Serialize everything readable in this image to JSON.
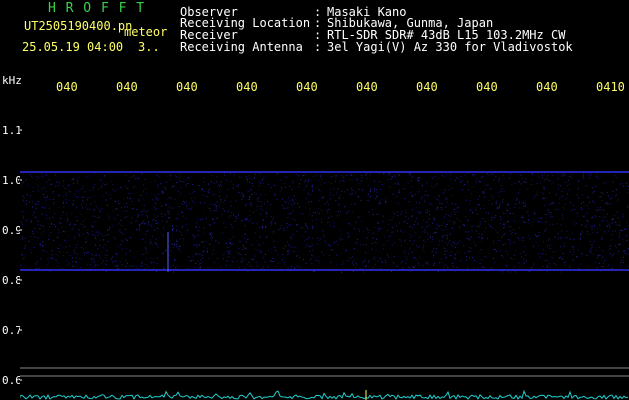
{
  "header": {
    "brand": "H R O F F T",
    "filename": "UT2505190400.pn",
    "meteor_label": "meteor",
    "datetime": "25.05.19 04:00",
    "count": "3..",
    "info": [
      {
        "label": "Observer",
        "sep": ":",
        "value": "Masaki Kano"
      },
      {
        "label": "Receiving Location",
        "sep": ":",
        "value": "Shibukawa, Gunma, Japan"
      },
      {
        "label": "Receiver",
        "sep": ":",
        "value": "RTL-SDR SDR# 43dB L15 103.2MHz CW"
      },
      {
        "label": "Receiving Antenna",
        "sep": ":",
        "value": "3el Yagi(V) Az 330 for Vladivostok"
      }
    ]
  },
  "axis": {
    "unit": "kHz",
    "time_ticks": [
      "040",
      "040",
      "040",
      "040",
      "040",
      "040",
      "040",
      "040",
      "040",
      "0410"
    ],
    "freq_ticks": [
      "1.1",
      "1.0",
      "0.9",
      "0.8",
      "0.7",
      "0.6"
    ]
  },
  "colors": {
    "header_brand": "#3cd14a",
    "header_text": "#ffffff",
    "time_labels": "#ffff66",
    "signal_band": "#2b2bd6",
    "baseline": "#20d0d0"
  }
}
